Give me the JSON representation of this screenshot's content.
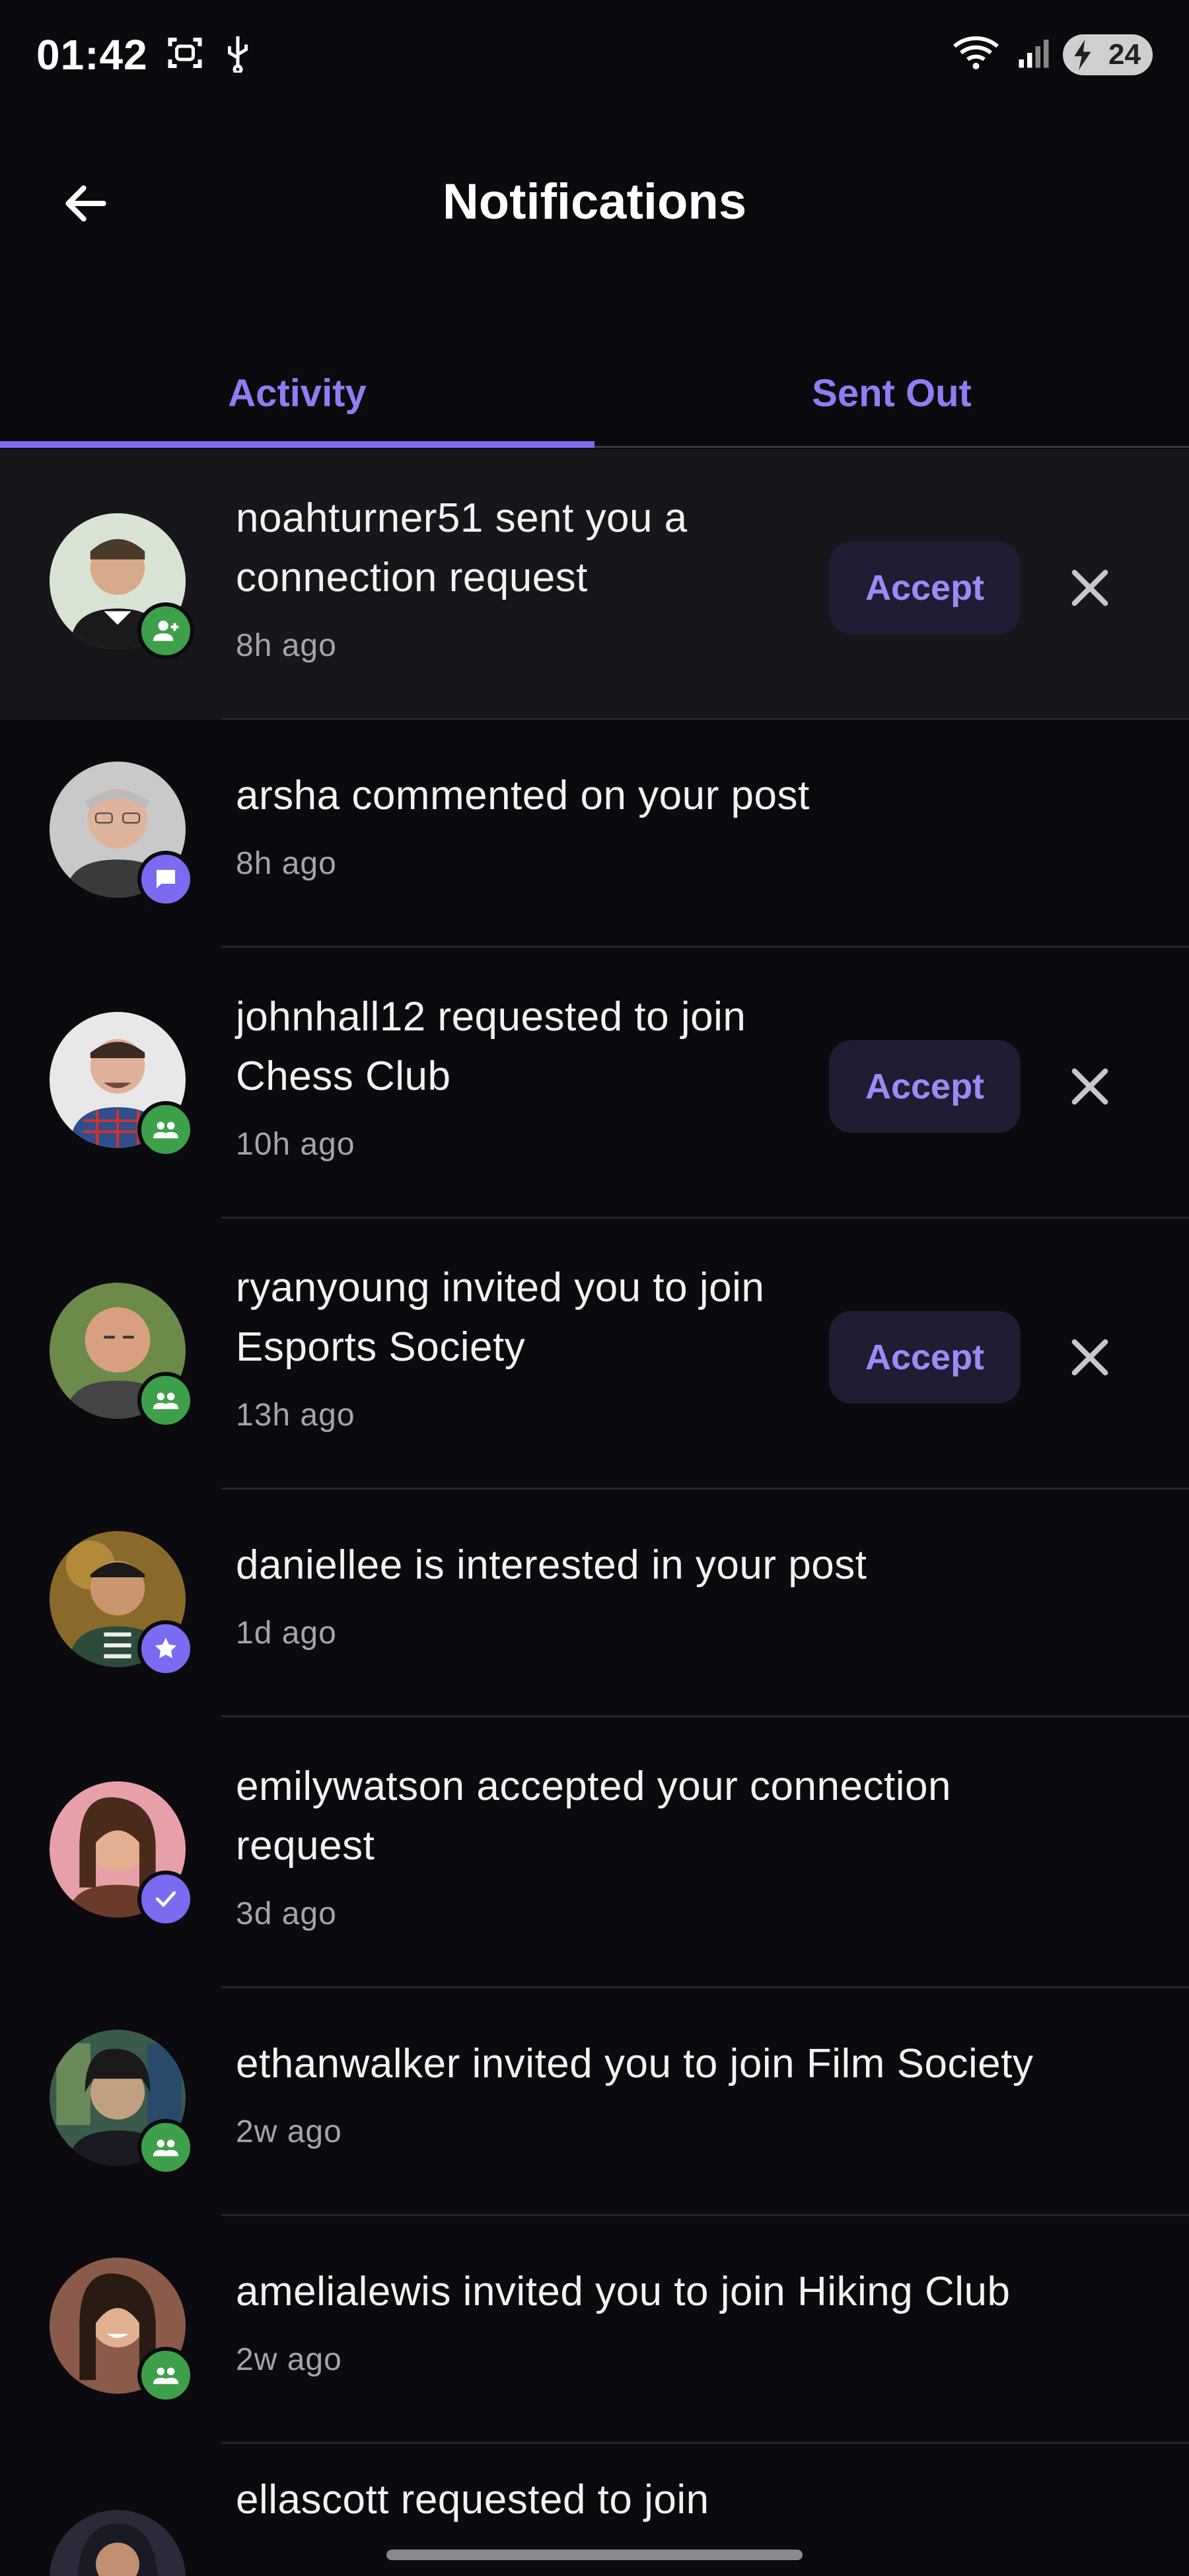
{
  "status_bar": {
    "time": "01:42",
    "battery": "24"
  },
  "header": {
    "title": "Notifications"
  },
  "tabs": [
    {
      "label": "Activity",
      "active": true
    },
    {
      "label": "Sent Out",
      "active": false
    }
  ],
  "accept_label": "Accept",
  "notifications": [
    {
      "text_line1": "noahturner51 sent you a",
      "text_line2": "connection request",
      "ago": "8h ago",
      "badge": "person-add",
      "badge_color": "#3ea04a",
      "actions": true
    },
    {
      "text_line1": "arsha commented on your post",
      "text_line2": "",
      "ago": "8h ago",
      "badge": "comment",
      "badge_color": "#7b6bf0",
      "actions": false
    },
    {
      "text_line1": "johnhall12 requested to join",
      "text_line2": "Chess Club",
      "ago": "10h ago",
      "badge": "group",
      "badge_color": "#3ea04a",
      "actions": true
    },
    {
      "text_line1": "ryanyoung invited you to join",
      "text_line2": "Esports Society",
      "ago": "13h ago",
      "badge": "group",
      "badge_color": "#3ea04a",
      "actions": true
    },
    {
      "text_line1": "daniellee is interested in your post",
      "text_line2": "",
      "ago": "1d ago",
      "badge": "star",
      "badge_color": "#7b6bf0",
      "actions": false
    },
    {
      "text_line1": "emilywatson accepted your connection",
      "text_line2": "request",
      "ago": "3d ago",
      "badge": "check",
      "badge_color": "#7b6bf0",
      "actions": false
    },
    {
      "text_line1": "ethanwalker invited you to join Film Society",
      "text_line2": "",
      "ago": "2w ago",
      "badge": "group",
      "badge_color": "#3ea04a",
      "actions": false
    },
    {
      "text_line1": "amelialewis invited you to join Hiking Club",
      "text_line2": "",
      "ago": "2w ago",
      "badge": "group",
      "badge_color": "#3ea04a",
      "actions": false
    },
    {
      "text_line1": "ellascott requested to join",
      "text_line2": "",
      "ago": "",
      "badge": "group",
      "badge_color": "#3ea04a",
      "actions": false
    }
  ]
}
